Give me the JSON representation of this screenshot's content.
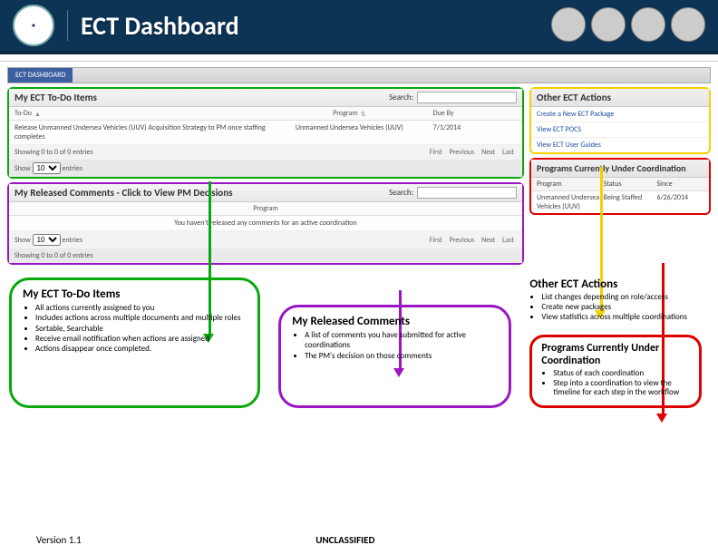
{
  "header": {
    "title": "ECT Dashboard"
  },
  "tabbar": {
    "active": "ECT DASHBOARD"
  },
  "todo": {
    "title": "My ECT To-Do Items",
    "searchLabel": "Search:",
    "searchValue": "",
    "cols": {
      "c1": "To-Do",
      "c2": "Program",
      "c3": "Due By"
    },
    "row": {
      "c1": "Release Unmanned Undersea Vehicles (UUV) Acquisition Strategy to PM once staffing completes",
      "c2": "Unmanned Undersea Vehicles (UUV)",
      "c3": "7/1/2014"
    },
    "footLeft1": "Show",
    "footSelect": "10",
    "footLeft2": "entries",
    "footShowing": "Showing 0 to 0 of 0 entries",
    "pager": {
      "first": "First",
      "prev": "Previous",
      "next": "Next",
      "last": "Last"
    }
  },
  "released": {
    "title": "My Released Comments - Click to View PM Decisions",
    "searchLabel": "Search:",
    "searchValue": "",
    "cols": {
      "c1": "Program"
    },
    "emptyMsg": "You haven't released any comments for an active coordination",
    "footLeft1": "Show",
    "footSelect": "10",
    "footLeft2": "entries",
    "footShowing": "Showing 0 to 0 of 0 entries",
    "pager": {
      "first": "First",
      "prev": "Previous",
      "next": "Next",
      "last": "Last"
    }
  },
  "other": {
    "title": "Other ECT Actions",
    "links": {
      "a": "Create a New ECT Package",
      "b": "View ECT POCS",
      "c": "View ECT User Guides"
    }
  },
  "programs": {
    "title": "Programs Currently Under Coordination",
    "cols": {
      "c1": "Program",
      "c2": "Status",
      "c3": "Since"
    },
    "row": {
      "c1": "Unmanned Undersea Vehicles (UUV)",
      "c2": "Being Staffed",
      "c3": "6/26/2014"
    }
  },
  "anno": {
    "todo": {
      "title": "My ECT To-Do Items",
      "i1": "All actions currently assigned to you",
      "i2": "Includes actions across multiple documents and multiple roles",
      "i3": "Sortable, Searchable",
      "i4": "Receive email notification when actions are assigned",
      "i5": "Actions disappear once completed."
    },
    "released": {
      "title": "My Released Comments",
      "i1": "A list of comments you have submitted for active coordinations",
      "i2": "The PM's decision on those comments"
    },
    "other": {
      "title": "Other ECT Actions",
      "i1": "List changes depending on role/access",
      "i2": "Create new packages",
      "i3": "View statistics across multiple coordinations"
    },
    "programs": {
      "title": "Programs Currently Under Coordination",
      "i1": "Status of each coordination",
      "i2": "Step into a coordination to view the timeline for each step in the workflow"
    }
  },
  "footer": {
    "version": "Version 1.1",
    "class": "UNCLASSIFIED"
  }
}
